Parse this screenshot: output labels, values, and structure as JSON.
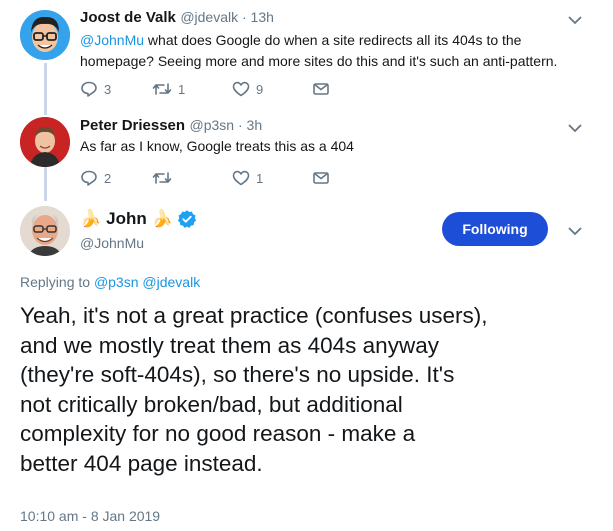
{
  "tweet1": {
    "name": "Joost de Valk",
    "meta": "@jdevalk · 13h",
    "mention": "@JohnMu",
    "text_line1_rest": " what does Google do when a site redirects all its 404s to the",
    "text_line2": "homepage? Seeing more and more sites do this and it's such an anti-pattern.",
    "replies": "3",
    "retweets": "1",
    "likes": "9"
  },
  "tweet2": {
    "name": "Peter Driessen",
    "meta": "@p3sn · 3h",
    "text": "As far as I know, Google treats this as a 404",
    "replies": "2",
    "retweets": "",
    "likes": "1"
  },
  "main": {
    "name": "John",
    "emoji_left": "🍌",
    "emoji_right": "🍌",
    "handle": "@JohnMu",
    "follow_label": "Following",
    "replying_prefix": "Replying to ",
    "replying_users": [
      "@p3sn",
      "@jdevalk"
    ],
    "text_lines": [
      "Yeah, it's not a great practice (confuses users),",
      "and we mostly treat them as 404s anyway",
      "(they're soft-404s), so there's no upside. It's",
      "not critically broken/bad, but additional",
      "complexity for no good reason - make a",
      "better 404 page instead."
    ],
    "timestamp": "10:10 am - 8 Jan 2019"
  },
  "colors": {
    "accent": "#1da1f2",
    "button": "#1d4ed8",
    "muted": "#657786",
    "thread": "#cdd6e8"
  }
}
